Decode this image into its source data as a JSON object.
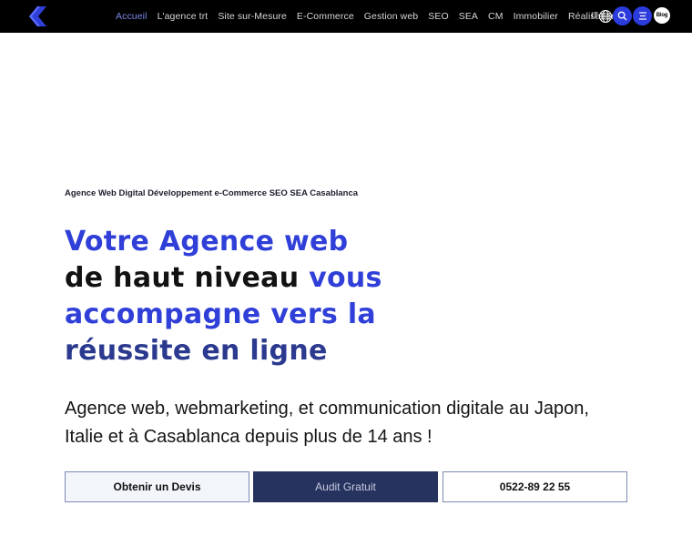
{
  "nav": {
    "items": [
      {
        "label": "Accueil",
        "active": true
      },
      {
        "label": "L'agence trt",
        "active": false
      },
      {
        "label": "Site sur-Mesure",
        "active": false
      },
      {
        "label": "E-Commerce",
        "active": false
      },
      {
        "label": "Gestion web",
        "active": false
      },
      {
        "label": "SEO",
        "active": false
      },
      {
        "label": "SEA",
        "active": false
      },
      {
        "label": "CM",
        "active": false
      },
      {
        "label": "Immobilier",
        "active": false
      },
      {
        "label": "Réalisations",
        "active": false
      }
    ],
    "lang": "IT",
    "blog_label": "Blog"
  },
  "hero": {
    "tagline": "Agence Web Digital Développement e-Commerce SEO SEA Casablanca",
    "headline": {
      "part1": "Votre Agence web",
      "part2": "de haut niveau",
      "part3": "vous",
      "part4": "accompagne vers la",
      "part5": "réussite en ligne"
    },
    "lead": "Agence web, webmarketing, et communication digitale au Japon, Italie et à Casablanca depuis plus de 14 ans !"
  },
  "buttons": {
    "devis": "Obtenir un Devis",
    "audit": "Audit Gratuit",
    "phone": "0522-89 22 55"
  },
  "colors": {
    "accent_blue": "#2f3fd8",
    "navy": "#2b3a8f",
    "button_dark": "#26335e",
    "topbar": "#000000"
  }
}
